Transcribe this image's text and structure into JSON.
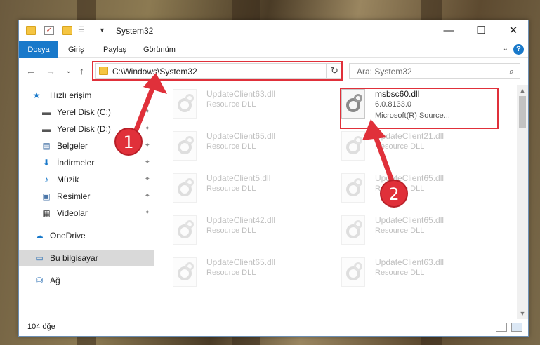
{
  "window": {
    "title": "System32",
    "min_glyph": "—",
    "max_glyph": "☐",
    "close_glyph": "✕"
  },
  "ribbon": {
    "tabs": [
      "Dosya",
      "Giriş",
      "Paylaş",
      "Görünüm"
    ],
    "help_label": "?",
    "expand_glyph": "⌄"
  },
  "navigation": {
    "back_glyph": "←",
    "forward_glyph": "→",
    "recent_glyph": "⌄",
    "up_glyph": "↑",
    "address": "C:\\Windows\\System32",
    "address_chevron": "⌄",
    "refresh_glyph": "↻",
    "search_placeholder": "Ara: System32",
    "search_glyph": "⌕"
  },
  "sidebar": {
    "items": [
      {
        "label": "Hızlı erişim",
        "icon": "star-icon",
        "glyph": "★",
        "pinned": false
      },
      {
        "label": "Yerel Disk (C:)",
        "icon": "drive-icon",
        "glyph": "▬",
        "pinned": true
      },
      {
        "label": "Yerel Disk (D:)",
        "icon": "drive-icon",
        "glyph": "▬",
        "pinned": true
      },
      {
        "label": "Belgeler",
        "icon": "documents-icon",
        "glyph": "▤",
        "pinned": true
      },
      {
        "label": "İndirmeler",
        "icon": "downloads-icon",
        "glyph": "⬇",
        "pinned": true
      },
      {
        "label": "Müzik",
        "icon": "music-icon",
        "glyph": "♪",
        "pinned": true
      },
      {
        "label": "Resimler",
        "icon": "pictures-icon",
        "glyph": "▣",
        "pinned": true
      },
      {
        "label": "Videolar",
        "icon": "videos-icon",
        "glyph": "▦",
        "pinned": true
      },
      {
        "label": "OneDrive",
        "icon": "cloud-icon",
        "glyph": "☁",
        "pinned": false
      },
      {
        "label": "Bu bilgisayar",
        "icon": "computer-icon",
        "glyph": "▭",
        "pinned": false,
        "selected": true
      },
      {
        "label": "Ağ",
        "icon": "network-icon",
        "glyph": "⛁",
        "pinned": false
      }
    ],
    "pin_glyph": "✦"
  },
  "files": {
    "highlighted": {
      "name": "msbsc60.dll",
      "version": "6.0.8133.0",
      "company": "Microsoft(R) Source..."
    },
    "faded": [
      {
        "name": "UpdateClient63.dll",
        "desc": "Resource DLL"
      },
      {
        "name": "UpdateClient65.dll",
        "desc": "Resource DLL"
      },
      {
        "name": "UpdateClient21.dll",
        "desc": "Resource DLL"
      },
      {
        "name": "UpdateClient5.dll",
        "desc": "Resource DLL"
      },
      {
        "name": "UpdateClient65.dll",
        "desc": "Resource DLL"
      },
      {
        "name": "UpdateClient42.dll",
        "desc": "Resource DLL"
      },
      {
        "name": "UpdateClient65.dll",
        "desc": "Resource DLL"
      },
      {
        "name": "UpdateClient65.dll",
        "desc": "Resource DLL"
      },
      {
        "name": "UpdateClient63.dll",
        "desc": "Resource DLL"
      }
    ]
  },
  "status": {
    "item_count": "104 öğe"
  },
  "callouts": [
    "1",
    "2"
  ],
  "colors": {
    "accent": "#1979ca",
    "highlight": "#e0303a"
  }
}
